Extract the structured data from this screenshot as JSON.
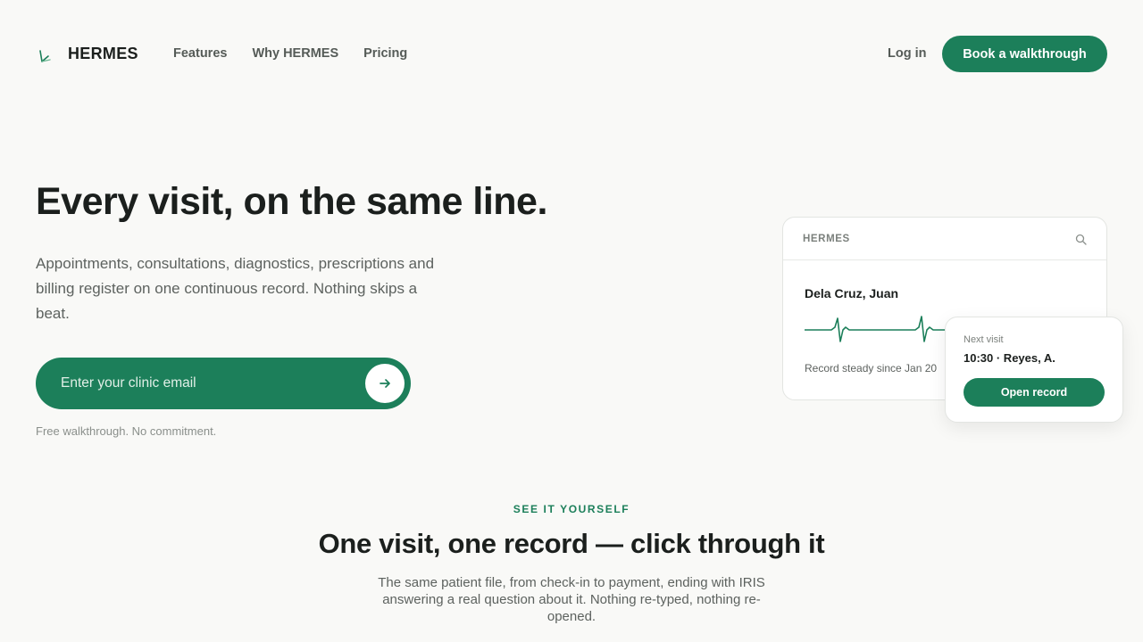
{
  "nav": {
    "brand": "HERMES",
    "links": [
      "Features",
      "Why HERMES",
      "Pricing"
    ],
    "login": "Log in",
    "cta": "Book a walkthrough"
  },
  "hero": {
    "title": "Every visit, on the same line.",
    "subtitle": "Appointments, consultations, diagnostics, prescriptions and billing register on one continuous record. Nothing skips a beat.",
    "email_placeholder": "Enter your clinic email",
    "fine_print": "Free walkthrough. No commitment."
  },
  "mock": {
    "brand": "HERMES",
    "patient": "Dela Cruz, Juan",
    "record_note": "Record steady since Jan 20",
    "next_visit_label": "Next visit",
    "next_visit_value": "10:30 · Reyes, A.",
    "open_record": "Open record"
  },
  "section": {
    "eyebrow": "SEE IT YOURSELF",
    "title": "One visit, one record — click through it",
    "subtitle": "The same patient file, from check-in to payment, ending with IRIS answering a real question about it. Nothing re-typed, nothing re-opened."
  },
  "colors": {
    "brand_green": "#1c7f5a",
    "background": "#f9f9f7"
  },
  "icons": {
    "logo": "leaf-logo-icon",
    "submit": "arrow-right-icon",
    "search": "search-icon",
    "ecg": "heartbeat-line-icon"
  }
}
